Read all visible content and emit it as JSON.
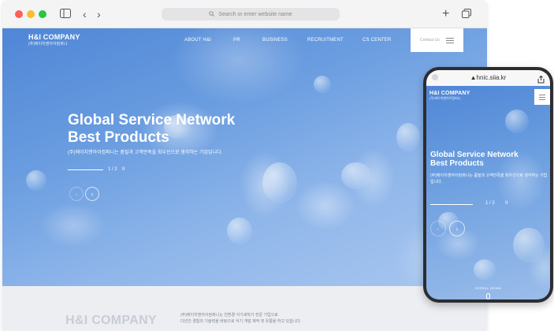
{
  "browser": {
    "address_placeholder": "Search or enter website name",
    "icons": [
      "sidebar-icon",
      "back-icon",
      "forward-icon",
      "search-icon",
      "plus-icon",
      "tabs-icon"
    ]
  },
  "site": {
    "logo": {
      "main": "H&I COMPANY",
      "sub": "(주)에이치앤아이컴퍼니"
    },
    "nav": [
      "ABOUT H&I",
      "PR",
      "BUSINESS",
      "RECRUITMENT",
      "CS CENTER"
    ],
    "contact_label": "Contact Us",
    "hero": {
      "title_line1": "Global Service Network",
      "title_line2": "Best Products",
      "subtitle": "(주)에이치앤아이컴퍼니는 품질과 고객만족을 최우선으로 생각하는 기업입니다.",
      "pager": "1 / 2",
      "pause": "II",
      "prev": "‹",
      "next": "›"
    },
    "footer": {
      "company": "H&I COMPANY",
      "desc_line1": "(주)에이치앤아이컴퍼니는 친환경 식기세척기 전문 기업으로",
      "desc_line2": "다년간 경험과 기술력을 바탕으로 식기 개발 제작 및 유통을 하고 있습니다."
    }
  },
  "phone": {
    "url": "▲hnic.siia.kr",
    "logo": {
      "main": "H&I COMPANY",
      "sub": "(주)에이치앤아이컴퍼니"
    },
    "hero": {
      "title_line1": "Global Service Network",
      "title_line2": "Best Products",
      "subtitle": "(주)에이치앤아이컴퍼니는 품질과 고객만족을 최우선으로 생각하는 기업입니다.",
      "pager": "1 / 2",
      "pause": "II",
      "prev": "‹",
      "next": "›"
    },
    "scroll_label": "SCROLL DOWN"
  }
}
